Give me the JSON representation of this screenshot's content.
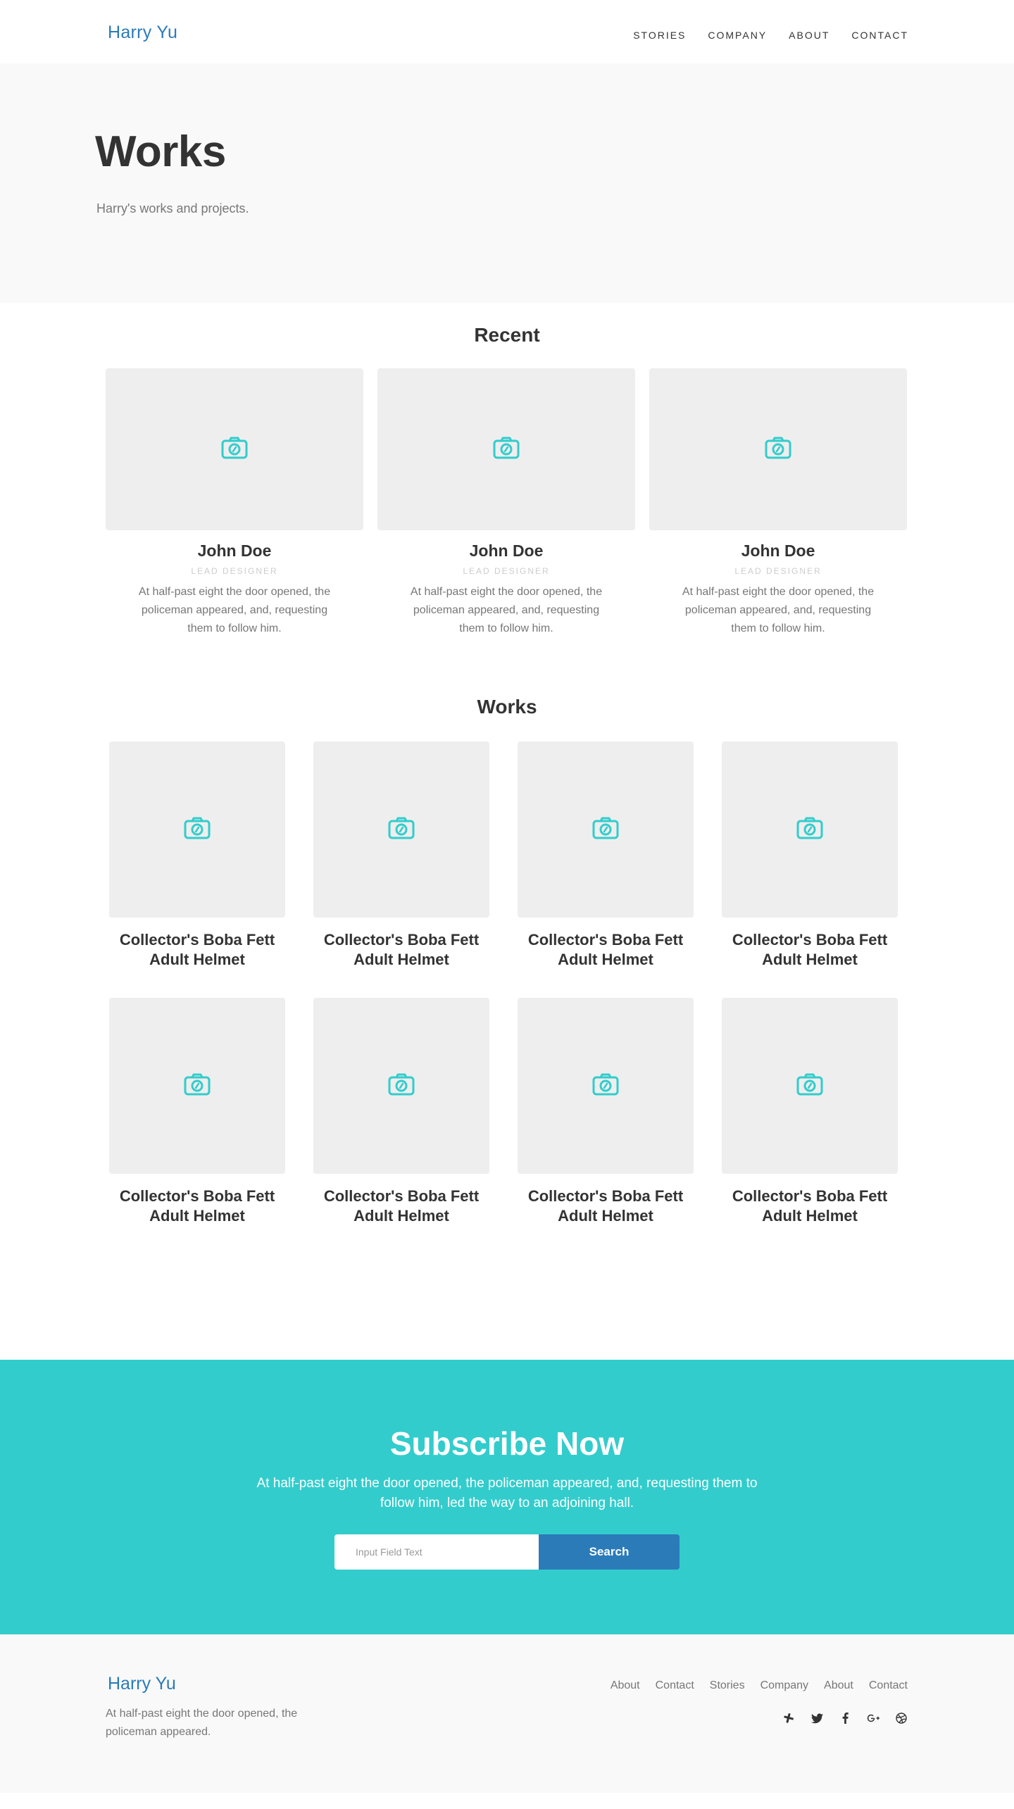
{
  "header": {
    "logo": "Harry Yu",
    "nav": [
      "STORIES",
      "COMPANY",
      "ABOUT",
      "CONTACT"
    ]
  },
  "hero": {
    "title": "Works",
    "subtitle": "Harry's works and projects."
  },
  "recent": {
    "title": "Recent",
    "cards": [
      {
        "name": "John Doe",
        "role": "LEAD DESIGNER",
        "desc": "At half-past eight the door opened, the policeman appeared, and, requesting them to follow him.",
        "icon": "camera-icon"
      },
      {
        "name": "John Doe",
        "role": "LEAD DESIGNER",
        "desc": "At half-past eight the door opened, the policeman appeared, and, requesting them to follow him.",
        "icon": "camera-icon"
      },
      {
        "name": "John Doe",
        "role": "LEAD DESIGNER",
        "desc": "At half-past eight the door opened, the policeman appeared, and, requesting them to follow him.",
        "icon": "camera-icon"
      }
    ]
  },
  "works": {
    "title": "Works",
    "items": [
      {
        "title": "Collector's Boba Fett Adult Helmet"
      },
      {
        "title": "Collector's Boba Fett Adult Helmet"
      },
      {
        "title": "Collector's Boba Fett Adult Helmet"
      },
      {
        "title": "Collector's Boba Fett Adult Helmet"
      },
      {
        "title": "Collector's Boba Fett Adult Helmet"
      },
      {
        "title": "Collector's Boba Fett Adult Helmet"
      },
      {
        "title": "Collector's Boba Fett Adult Helmet"
      },
      {
        "title": "Collector's Boba Fett Adult Helmet"
      }
    ]
  },
  "subscribe": {
    "title": "Subscribe Now",
    "text": "At half-past eight the door opened, the policeman appeared, and, requesting them to follow him, led the way to an adjoining hall.",
    "input_placeholder": "Input Field Text",
    "button_label": "Search"
  },
  "footer": {
    "logo": "Harry Yu",
    "desc": "At half-past eight the door opened, the policeman appeared.",
    "links": [
      "About",
      "Contact",
      "Stories",
      "Company",
      "About",
      "Contact"
    ],
    "social_icons": [
      "slack-icon",
      "twitter-icon",
      "facebook-icon",
      "google-plus-icon",
      "dribbble-icon"
    ]
  },
  "colors": {
    "accent": "#33cccc",
    "brand_blue": "#2b7bb9",
    "text_dark": "#333333",
    "text_muted": "#777777",
    "placeholder_bg": "#eeeeee",
    "section_bg": "#f9f9f9"
  }
}
